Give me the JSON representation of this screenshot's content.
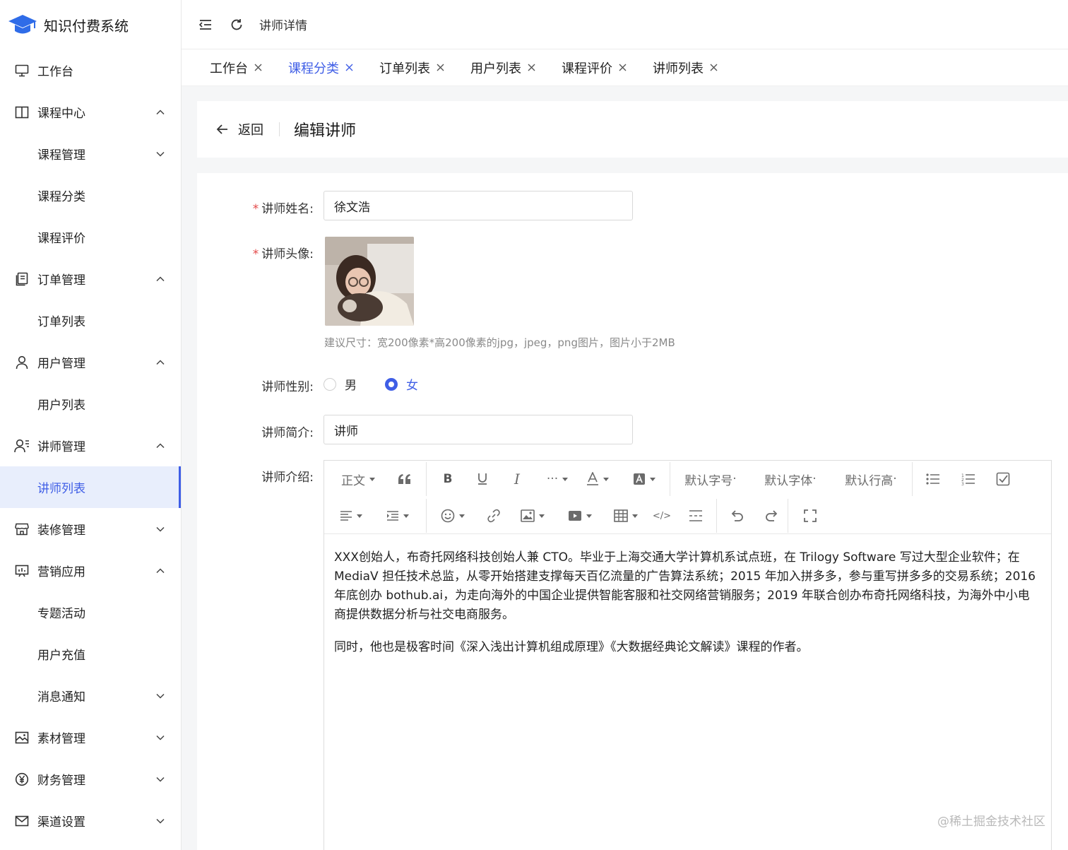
{
  "app": {
    "title": "知识付费系统"
  },
  "sidebar": {
    "items": [
      {
        "label": "工作台",
        "icon": "monitor-icon",
        "level": 0,
        "chevron": ""
      },
      {
        "label": "课程中心",
        "icon": "book-icon",
        "level": 0,
        "chevron": "up"
      },
      {
        "label": "课程管理",
        "icon": "",
        "level": 1,
        "chevron": "down"
      },
      {
        "label": "课程分类",
        "icon": "",
        "level": 1,
        "chevron": ""
      },
      {
        "label": "课程评价",
        "icon": "",
        "level": 1,
        "chevron": ""
      },
      {
        "label": "订单管理",
        "icon": "order-icon",
        "level": 0,
        "chevron": "up"
      },
      {
        "label": "订单列表",
        "icon": "",
        "level": 1,
        "chevron": ""
      },
      {
        "label": "用户管理",
        "icon": "user-icon",
        "level": 0,
        "chevron": "up"
      },
      {
        "label": "用户列表",
        "icon": "",
        "level": 1,
        "chevron": ""
      },
      {
        "label": "讲师管理",
        "icon": "teacher-icon",
        "level": 0,
        "chevron": "up"
      },
      {
        "label": "讲师列表",
        "icon": "",
        "level": 1,
        "chevron": "",
        "active": true
      },
      {
        "label": "装修管理",
        "icon": "shop-icon",
        "level": 0,
        "chevron": "down"
      },
      {
        "label": "营销应用",
        "icon": "marketing-icon",
        "level": 0,
        "chevron": "up"
      },
      {
        "label": "专题活动",
        "icon": "",
        "level": 1,
        "chevron": ""
      },
      {
        "label": "用户充值",
        "icon": "",
        "level": 1,
        "chevron": ""
      },
      {
        "label": "消息通知",
        "icon": "",
        "level": 1,
        "chevron": "down"
      },
      {
        "label": "素材管理",
        "icon": "image-icon",
        "level": 0,
        "chevron": "down"
      },
      {
        "label": "财务管理",
        "icon": "yen-icon",
        "level": 0,
        "chevron": "down"
      },
      {
        "label": "渠道设置",
        "icon": "mail-icon",
        "level": 0,
        "chevron": "down"
      }
    ]
  },
  "header": {
    "breadcrumb": "讲师详情"
  },
  "tabs": [
    {
      "label": "工作台",
      "active": false
    },
    {
      "label": "课程分类",
      "active": true
    },
    {
      "label": "订单列表",
      "active": false
    },
    {
      "label": "用户列表",
      "active": false
    },
    {
      "label": "课程评价",
      "active": false
    },
    {
      "label": "讲师列表",
      "active": false
    }
  ],
  "page": {
    "back_label": "返回",
    "title": "编辑讲师"
  },
  "form": {
    "name_label": "讲师姓名:",
    "name_value": "徐文浩",
    "avatar_label": "讲师头像:",
    "avatar_hint": "建议尺寸：宽200像素*高200像素的jpg，jpeg，png图片，图片小于2MB",
    "gender_label": "讲师性别:",
    "gender_options": [
      "男",
      "女"
    ],
    "gender_selected": "女",
    "brief_label": "讲师简介:",
    "brief_value": "讲师",
    "intro_label": "讲师介绍:"
  },
  "editor": {
    "toolbar": {
      "paragraph": "正文",
      "font_size": "默认字号",
      "font_family": "默认字体",
      "line_height": "默认行高"
    },
    "paragraphs": [
      "XXX创始人，布奇托网络科技创始人兼 CTO。毕业于上海交通大学计算机系试点班，在 Trilogy Software 写过大型企业软件；在 MediaV 担任技术总监，从零开始搭建支撑每天百亿流量的广告算法系统；2015 年加入拼多多，参与重写拼多多的交易系统；2016 年底创办 bothub.ai，为走向海外的中国企业提供智能客服和社交网络营销服务；2019 年联合创办布奇托网络科技，为海外中小电商提供数据分析与社交电商服务。",
      "同时，他也是极客时间《深入浅出计算机组成原理》《大数据经典论文解读》课程的作者。"
    ]
  },
  "watermark": "@稀土掘金技术社区",
  "colors": {
    "accent": "#3f5ee6",
    "required": "#e34848"
  }
}
